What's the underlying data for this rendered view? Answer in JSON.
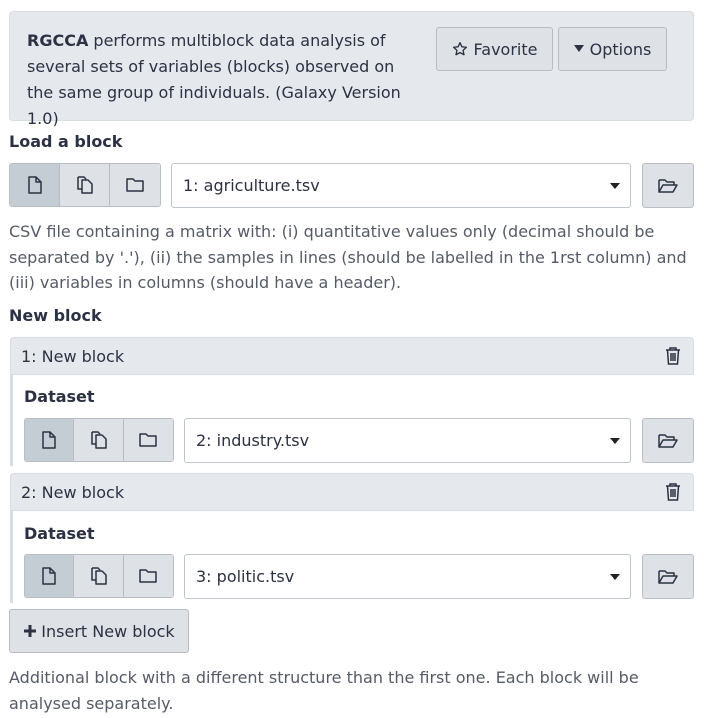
{
  "header": {
    "tool_name": "RGCCA",
    "description": " performs multiblock data analysis of several sets of variables (blocks) observed on the same group of individuals. (Galaxy Version 1.0)",
    "favorite_label": "Favorite",
    "options_label": "Options"
  },
  "load_block": {
    "label": "Load a block",
    "selected": "1: agriculture.tsv",
    "help": "CSV file containing a matrix with: (i) quantitative values only (decimal should be separated by '.'), (ii) the samples in lines (should be labelled in the 1rst column) and (iii) variables in columns (should have a header)."
  },
  "new_block": {
    "label": "New block",
    "blocks": [
      {
        "title": "1: New block",
        "dataset_label": "Dataset",
        "selected": "2: industry.tsv"
      },
      {
        "title": "2: New block",
        "dataset_label": "Dataset",
        "selected": "3: politic.tsv"
      }
    ],
    "insert_label": "Insert New block",
    "help": "Additional block with a different structure than the first one. Each block will be analysed separately."
  },
  "icons": [
    "star-icon",
    "caret-down-icon",
    "file-icon",
    "files-icon",
    "folder-icon",
    "folder-open-icon",
    "trash-icon",
    "plus-icon"
  ]
}
